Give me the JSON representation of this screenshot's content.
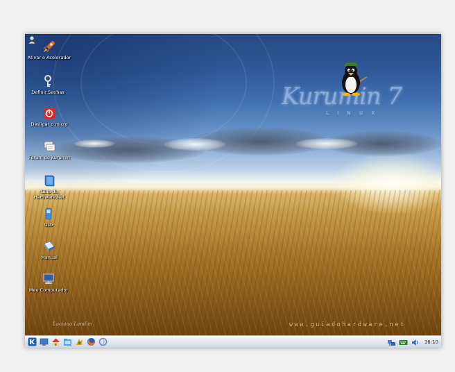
{
  "desktop": {
    "icons": [
      {
        "label": "Ativar o Acelerador",
        "icon": "rocket-icon"
      },
      {
        "label": "Definir Senhas",
        "icon": "key-icon"
      },
      {
        "label": "Desligar o micro",
        "icon": "power-icon"
      },
      {
        "label": "Forum do Kurumin",
        "icon": "forum-icon"
      },
      {
        "label": "Guia do Hardware.Net",
        "icon": "book-icon"
      },
      {
        "label": "Usb",
        "icon": "usb-drive-icon"
      },
      {
        "label": "Manual",
        "icon": "manual-icon"
      },
      {
        "label": "Meu Computador",
        "icon": "computer-icon"
      }
    ],
    "wallpaper": {
      "logo_text": "Kurumin 7",
      "logo_sub": "L I N U X",
      "watermark": "www.guiadohardware.net",
      "signature": "Luciano Landim"
    }
  },
  "taskbar": {
    "launchers": [
      {
        "icon": "kmenu-icon"
      },
      {
        "icon": "show-desktop-icon"
      },
      {
        "icon": "home-icon"
      },
      {
        "icon": "file-manager-icon"
      },
      {
        "icon": "web-browser-icon"
      },
      {
        "icon": "firefox-icon"
      },
      {
        "icon": "konqueror-icon"
      }
    ],
    "tray": [
      {
        "icon": "network-icon"
      },
      {
        "icon": "keyboard-layout-icon"
      },
      {
        "icon": "volume-icon"
      }
    ],
    "clock": "16:10"
  },
  "colors": {
    "sky_top": "#274a85",
    "wheat": "#c69a45",
    "taskbar": "#dde3ec",
    "frame_bg": "#f0f0f0"
  }
}
